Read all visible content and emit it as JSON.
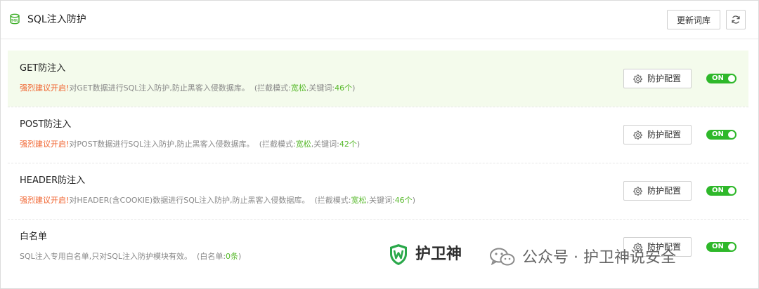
{
  "header": {
    "title": "SQL注入防护",
    "icon": "database-sql-icon",
    "update_label": "更新词库",
    "refresh_icon": "refresh-icon"
  },
  "colors": {
    "accent_green": "#58b92c",
    "warning_red": "#f0622d",
    "toggle_green": "#2eb82a",
    "highlight_bg": "#f4fbec"
  },
  "rows": [
    {
      "title": "GET防注入",
      "warn": "强烈建议开启!",
      "desc": "对GET数据进行SQL注入防护,防止黑客入侵数据库。",
      "mode_prefix": "(拦截模式:",
      "mode_value": "宽松",
      "kw_prefix": ",关键词:",
      "kw_value": "46个",
      "suffix": ")",
      "config_label": "防护配置",
      "toggle_label": "ON"
    },
    {
      "title": "POST防注入",
      "warn": "强烈建议开启!",
      "desc": "对POST数据进行SQL注入防护,防止黑客入侵数据库。",
      "mode_prefix": "(拦截模式:",
      "mode_value": "宽松",
      "kw_prefix": ",关键词:",
      "kw_value": "42个",
      "suffix": ")",
      "config_label": "防护配置",
      "toggle_label": "ON"
    },
    {
      "title": "HEADER防注入",
      "warn": "强烈建议开启!",
      "desc": "对HEADER(含COOKIE)数据进行SQL注入防护,防止黑客入侵数据库。",
      "mode_prefix": "(拦截模式:",
      "mode_value": "宽松",
      "kw_prefix": ",关键词:",
      "kw_value": "46个",
      "suffix": ")",
      "config_label": "防护配置",
      "toggle_label": "ON"
    },
    {
      "title": "白名单",
      "desc": "SQL注入专用白名单,只对SQL注入防护模块有效。",
      "wl_prefix": "(白名单:",
      "wl_value": "0条",
      "suffix": ")",
      "config_label": "防护配置",
      "toggle_label": "ON"
    }
  ],
  "watermark": {
    "brand": "护卫神",
    "channel": "公众号 · 护卫神说安全"
  }
}
